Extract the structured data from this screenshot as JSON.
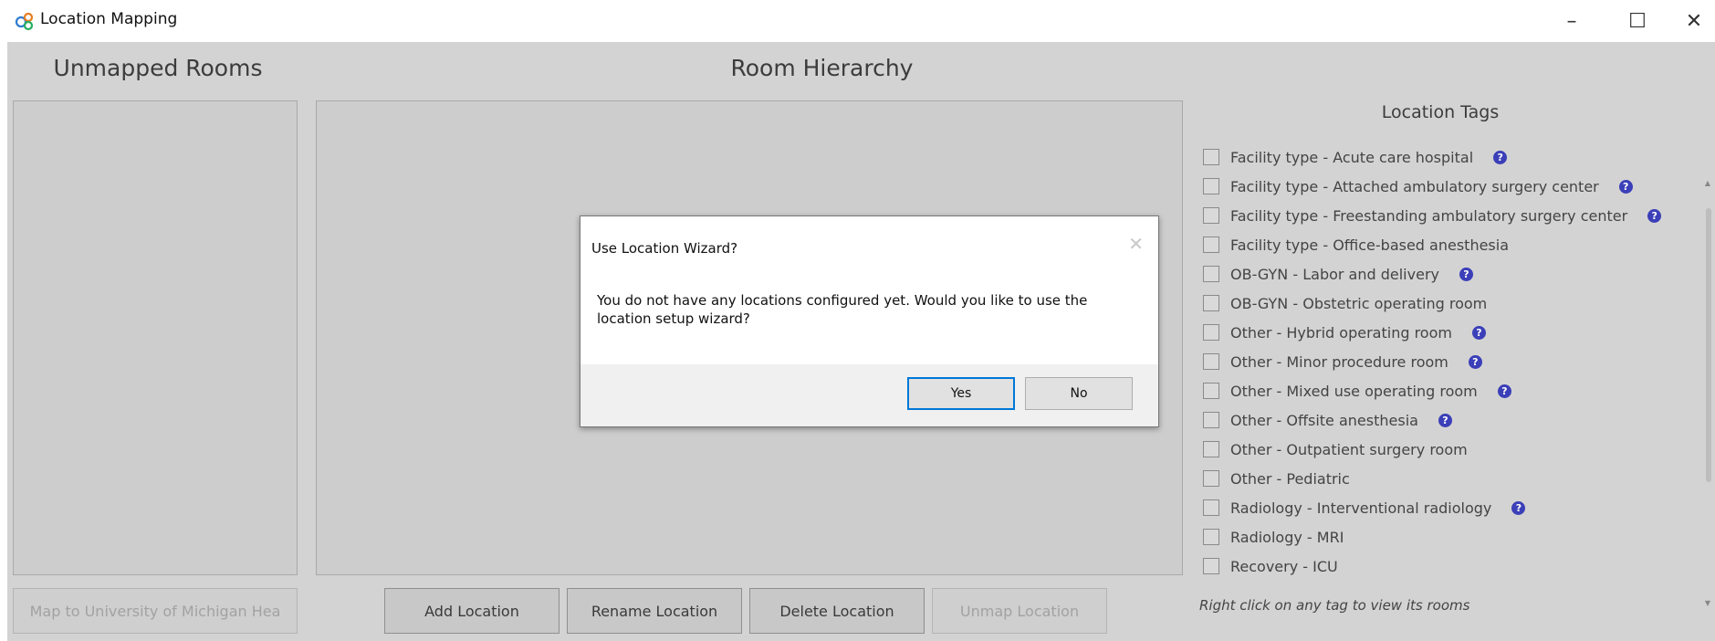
{
  "window": {
    "title": "Location Mapping",
    "minimize_glyph": "–",
    "maximize_glyph": "☐",
    "close_glyph": "✕"
  },
  "unmapped": {
    "header": "Unmapped Rooms",
    "map_button": "Map to University of Michigan Hea"
  },
  "hierarchy": {
    "header": "Room Hierarchy",
    "buttons": {
      "add": "Add Location",
      "rename": "Rename Location",
      "delete": "Delete Location",
      "unmap": "Unmap Location"
    }
  },
  "tags": {
    "title": "Location Tags",
    "hint": "Right click on any tag to view its rooms",
    "help_glyph": "?",
    "items": [
      {
        "label": "Facility type - Acute care hospital",
        "checked": false,
        "help": true
      },
      {
        "label": "Facility type - Attached ambulatory surgery center",
        "checked": false,
        "help": true
      },
      {
        "label": "Facility type - Freestanding ambulatory surgery center",
        "checked": false,
        "help": true
      },
      {
        "label": "Facility type - Office-based anesthesia",
        "checked": false,
        "help": false
      },
      {
        "label": "OB-GYN - Labor and delivery",
        "checked": false,
        "help": true
      },
      {
        "label": "OB-GYN - Obstetric operating room",
        "checked": false,
        "help": false
      },
      {
        "label": "Other - Hybrid operating room",
        "checked": false,
        "help": true
      },
      {
        "label": "Other - Minor procedure room",
        "checked": false,
        "help": true
      },
      {
        "label": "Other - Mixed use operating room",
        "checked": false,
        "help": true
      },
      {
        "label": "Other - Offsite anesthesia",
        "checked": false,
        "help": true
      },
      {
        "label": "Other - Outpatient surgery room",
        "checked": false,
        "help": false
      },
      {
        "label": "Other - Pediatric",
        "checked": false,
        "help": false
      },
      {
        "label": "Radiology - Interventional radiology",
        "checked": false,
        "help": true
      },
      {
        "label": "Radiology - MRI",
        "checked": false,
        "help": false
      },
      {
        "label": "Recovery - ICU",
        "checked": false,
        "help": false
      }
    ]
  },
  "dialog": {
    "title": "Use Location Wizard?",
    "close_glyph": "✕",
    "message": "You do not have any locations configured yet. Would you like to use the location setup wizard?",
    "yes": "Yes",
    "no": "No"
  },
  "colors": {
    "panel_bg": "#d3d3d3",
    "help_icon": "#3b3fb8",
    "default_button_border": "#0078d7"
  }
}
